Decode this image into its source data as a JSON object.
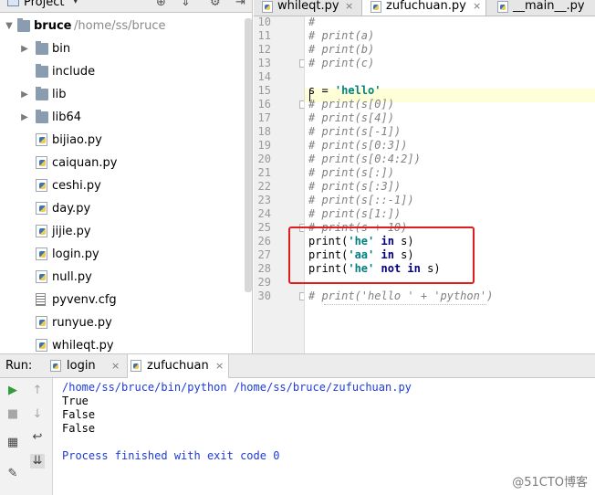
{
  "project": {
    "title": "Project",
    "tree": [
      {
        "label": "bruce",
        "path": "/home/ss/bruce",
        "type": "folder",
        "expanded": true,
        "level": 0
      },
      {
        "label": "bin",
        "type": "folder",
        "expanded": false,
        "level": 1
      },
      {
        "label": "include",
        "type": "folder",
        "level": 1
      },
      {
        "label": "lib",
        "type": "folder",
        "expanded": false,
        "level": 1
      },
      {
        "label": "lib64",
        "type": "folder-link",
        "expanded": false,
        "level": 1
      },
      {
        "label": "bijiao.py",
        "type": "python-file",
        "level": 1
      },
      {
        "label": "caiquan.py",
        "type": "python-file",
        "level": 1
      },
      {
        "label": "ceshi.py",
        "type": "python-file",
        "level": 1
      },
      {
        "label": "day.py",
        "type": "python-file",
        "level": 1
      },
      {
        "label": "jijie.py",
        "type": "python-file",
        "level": 1
      },
      {
        "label": "login.py",
        "type": "python-file",
        "level": 1
      },
      {
        "label": "null.py",
        "type": "python-file",
        "level": 1
      },
      {
        "label": "pyvenv.cfg",
        "type": "config-file",
        "level": 1
      },
      {
        "label": "runyue.py",
        "type": "python-file",
        "level": 1
      },
      {
        "label": "whileqt.py",
        "type": "python-file",
        "level": 1
      }
    ]
  },
  "editor": {
    "tabs": [
      {
        "label": "whileqt.py",
        "active": false
      },
      {
        "label": "zufuchuan.py",
        "active": true
      },
      {
        "label": "__main__.py",
        "active": false
      }
    ],
    "lines": [
      {
        "n": "10",
        "text": "#",
        "kind": "comment"
      },
      {
        "n": "11",
        "text": "# print(a)",
        "kind": "comment"
      },
      {
        "n": "12",
        "text": "# print(b)",
        "kind": "comment"
      },
      {
        "n": "13",
        "text": "# print(c)",
        "kind": "comment"
      },
      {
        "n": "14",
        "text": "",
        "kind": "code"
      },
      {
        "n": "15",
        "text": "s = 'hello'",
        "kind": "code"
      },
      {
        "n": "16",
        "text": "# print(s[0])",
        "kind": "comment"
      },
      {
        "n": "17",
        "text": "# print(s[4])",
        "kind": "comment"
      },
      {
        "n": "18",
        "text": "# print(s[-1])",
        "kind": "comment"
      },
      {
        "n": "19",
        "text": "# print(s[0:3])",
        "kind": "comment"
      },
      {
        "n": "20",
        "text": "# print(s[0:4:2])",
        "kind": "comment"
      },
      {
        "n": "21",
        "text": "# print(s[:])",
        "kind": "comment"
      },
      {
        "n": "22",
        "text": "# print(s[:3])",
        "kind": "comment"
      },
      {
        "n": "23",
        "text": "# print(s[::-1])",
        "kind": "comment"
      },
      {
        "n": "24",
        "text": "# print(s[1:])",
        "kind": "comment"
      },
      {
        "n": "25",
        "text": "# print(s + 10)",
        "kind": "comment"
      },
      {
        "n": "26",
        "text": "print('he' in s)",
        "kind": "code"
      },
      {
        "n": "27",
        "text": "print('aa' in s)",
        "kind": "code"
      },
      {
        "n": "28",
        "text": "print('he' not in s)",
        "kind": "code"
      },
      {
        "n": "29",
        "text": "",
        "kind": "code"
      },
      {
        "n": "30",
        "text": "# print('hello ' + 'python')",
        "kind": "comment"
      }
    ]
  },
  "run": {
    "label": "Run:",
    "tabs": [
      {
        "label": "login",
        "active": false
      },
      {
        "label": "zufuchuan",
        "active": true
      }
    ],
    "output": [
      {
        "text": "/home/ss/bruce/bin/python /home/ss/bruce/zufuchuan.py",
        "kind": "cmd"
      },
      {
        "text": "True",
        "kind": "ok"
      },
      {
        "text": "False",
        "kind": "ok"
      },
      {
        "text": "False",
        "kind": "ok"
      },
      {
        "text": "",
        "kind": "ok"
      },
      {
        "text": "Process finished with exit code 0",
        "kind": "exit"
      }
    ]
  },
  "watermark": "@51CTO博客",
  "colors": {
    "keyword": "#000080",
    "string": "#008080",
    "comment": "#808080",
    "console_info": "#1f3bd6",
    "highlight_box": "#e31b1b",
    "caret_line": "#ffffd7"
  }
}
